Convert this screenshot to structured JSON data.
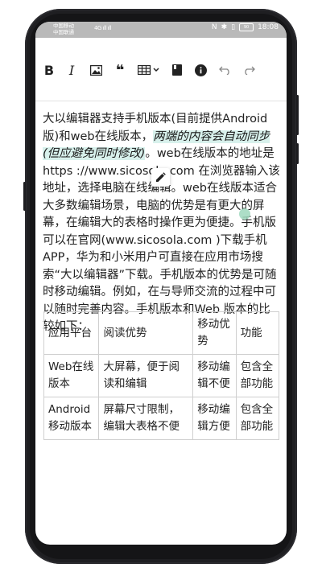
{
  "status_bar": {
    "carrier1": "中国移动",
    "carrier2": "中国联通",
    "signal": "4G ıll  ıll",
    "time": "18:08",
    "battery": "90"
  },
  "toolbar": {
    "bold_label": "B",
    "italic_label": "I",
    "quote_label": "❝"
  },
  "content": {
    "p1": "大以编辑器支持手机版本(目前提供Android版)和web在线版本，",
    "highlight": "两端的内容会自动同步(但应避免同时修改)",
    "p2": "。web在线版本的地址是https ://www.sicosola.com 在浏览器输入该地址，选择电脑在线编辑。web在线版本适合大多数编辑场景，电脑的优势是有更大的屏幕，在编辑大的表格时操作更为便捷。手机版可以在官网(www.sicosola.com )下载手机APP，华为和小米用户可直接在应用市场搜索“大以编辑器”下载。手机版本的优势是可随时移动编辑。例如，在与导师交流的过程中可以随时完善内容。手机版本和Web 版本的比较如下："
  },
  "table": {
    "rows": [
      [
        "应用平台",
        "阅读优势",
        "移动优势",
        "功能"
      ],
      [
        "Web在线版本",
        "大屏幕，便于阅读和编辑",
        "移动编辑不便",
        "包含全部功能"
      ],
      [
        "Android移动版本",
        "屏幕尺寸限制，编辑大表格不便",
        "移动编辑方便",
        "包含全部功能"
      ]
    ]
  },
  "colors": {
    "highlight": "#d8f1ec",
    "status_bar": "#b9b9b9"
  }
}
